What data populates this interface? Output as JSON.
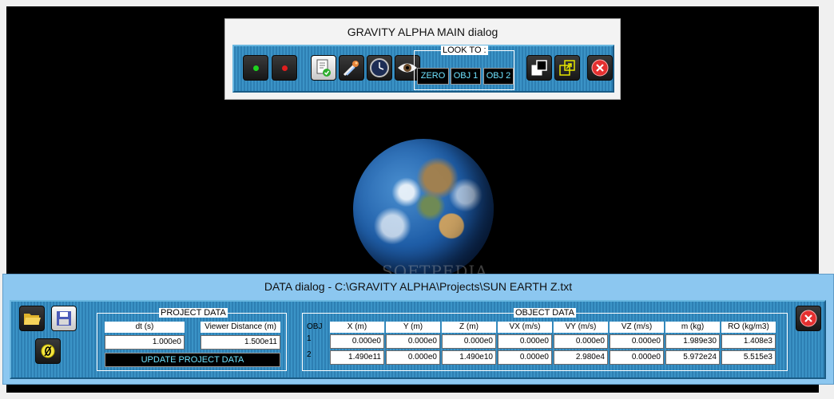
{
  "main": {
    "title": "GRAVITY ALPHA MAIN dialog",
    "lookto_label": "LOOK TO :",
    "look_buttons": [
      "ZERO",
      "OBJ 1",
      "OBJ 2"
    ],
    "start_color": "#1ed41e",
    "stop_color": "#e01e1e"
  },
  "watermark": "SOFTPEDIA",
  "data": {
    "title": "DATA dialog - C:\\GRAVITY ALPHA\\Projects\\SUN EARTH Z.txt",
    "project": {
      "label": "PROJECT DATA",
      "dt_label": "dt (s)",
      "dt_value": "1.000e0",
      "viewer_label": "Viewer Distance (m)",
      "viewer_value": "1.500e11",
      "update_label": "UPDATE PROJECT DATA"
    },
    "object": {
      "label": "OBJECT DATA",
      "obj_header": "OBJ",
      "columns": [
        "X (m)",
        "Y (m)",
        "Z (m)",
        "VX (m/s)",
        "VY (m/s)",
        "VZ (m/s)",
        "m (kg)",
        "RO (kg/m3)"
      ],
      "rows": [
        {
          "id": "1",
          "values": [
            "0.000e0",
            "0.000e0",
            "0.000e0",
            "0.000e0",
            "0.000e0",
            "0.000e0",
            "1.989e30",
            "1.408e3"
          ]
        },
        {
          "id": "2",
          "values": [
            "1.490e11",
            "0.000e0",
            "1.490e10",
            "0.000e0",
            "2.980e4",
            "0.000e0",
            "5.972e24",
            "5.515e3"
          ]
        }
      ]
    }
  }
}
